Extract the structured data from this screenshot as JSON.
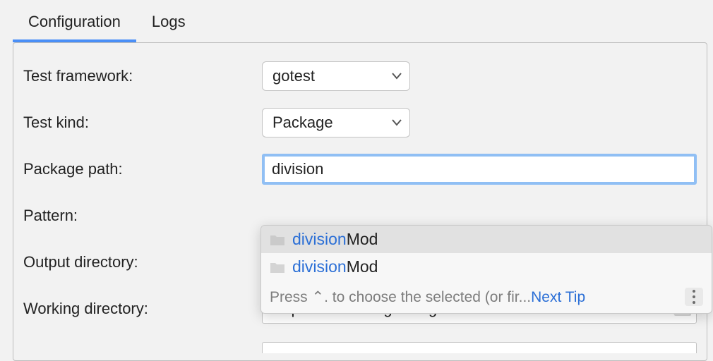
{
  "tabs": {
    "configuration": "Configuration",
    "logs": "Logs"
  },
  "labels": {
    "test_framework": "Test framework:",
    "test_kind": "Test kind:",
    "package_path": "Package path:",
    "pattern": "Pattern:",
    "output_directory": "Output directory:",
    "working_directory": "Working directory:"
  },
  "values": {
    "test_framework": "gotest",
    "test_kind": "Package",
    "package_path": "division",
    "working_directory": "amples/runDebugConfigurationsForTests"
  },
  "autocomplete": {
    "items": [
      {
        "match": "division",
        "rest": "Mod"
      },
      {
        "match": "division",
        "rest": "Mod"
      }
    ],
    "hint_prefix": "Press ",
    "hint_key": "⌃",
    "hint_suffix": ". to choose the selected (or fir...",
    "next_tip": "Next Tip"
  }
}
